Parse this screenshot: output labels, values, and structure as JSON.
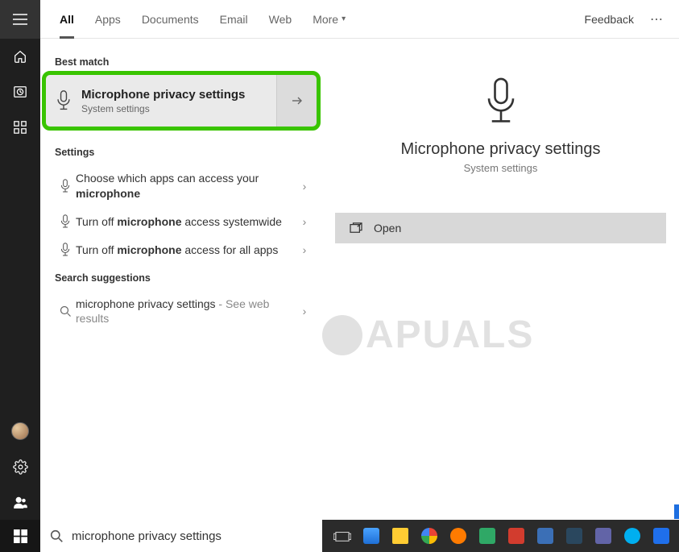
{
  "tabs": {
    "all": "All",
    "apps": "Apps",
    "documents": "Documents",
    "email": "Email",
    "web": "Web",
    "more": "More",
    "feedback": "Feedback"
  },
  "sections": {
    "best_match": "Best match",
    "settings": "Settings",
    "search_suggestions": "Search suggestions"
  },
  "best_match": {
    "title": "Microphone privacy settings",
    "subtitle": "System settings"
  },
  "settings_results": [
    {
      "pre": "Choose which apps can access your ",
      "bold": "microphone",
      "post": ""
    },
    {
      "pre": "Turn off ",
      "bold": "microphone",
      "post": " access systemwide"
    },
    {
      "pre": "Turn off ",
      "bold": "microphone",
      "post": " access for all apps"
    }
  ],
  "search_suggestion": {
    "text": "microphone privacy settings",
    "suffix": " - See web results"
  },
  "detail": {
    "title": "Microphone privacy settings",
    "subtitle": "System settings",
    "open": "Open"
  },
  "search": {
    "value": "microphone privacy settings"
  },
  "watermark": "APUALS"
}
